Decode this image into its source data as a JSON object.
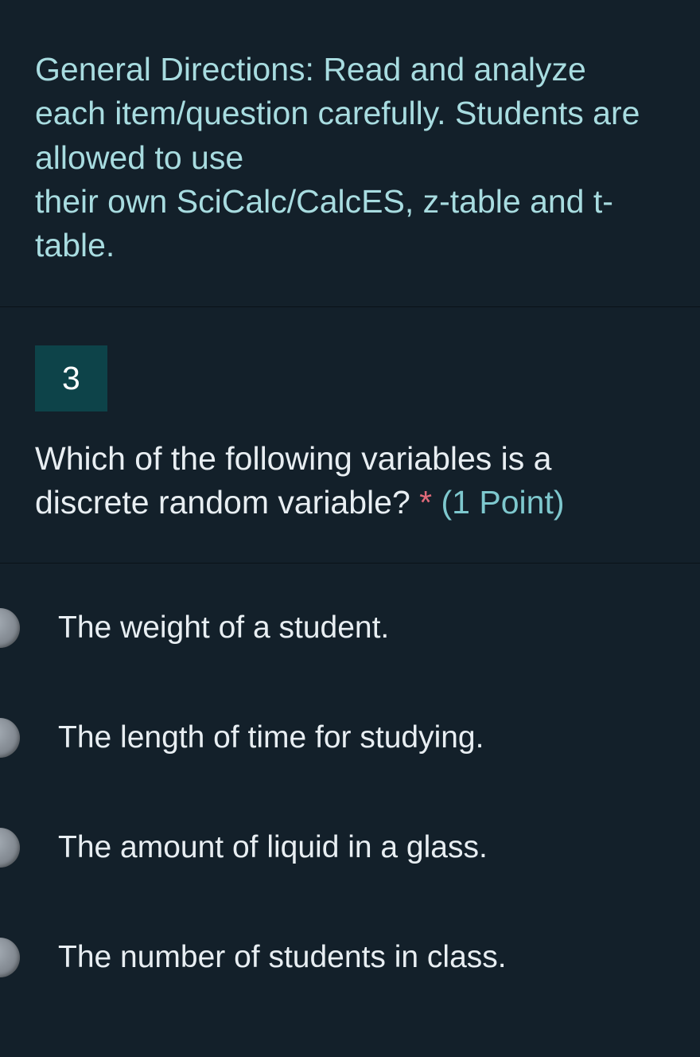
{
  "directions": {
    "text": "General Directions: Read and analyze each item/question carefully. Students are allowed to use\ntheir own SciCalc/CalcES, z-table and t-table."
  },
  "question": {
    "number": "3",
    "text": "Which of the following variables is a discrete random variable?",
    "required_mark": "*",
    "points": "(1 Point)"
  },
  "options": [
    {
      "label": "The weight of a student."
    },
    {
      "label": "The length of time for studying."
    },
    {
      "label": "The amount of liquid in a glass."
    },
    {
      "label": "The number of students in class."
    }
  ]
}
